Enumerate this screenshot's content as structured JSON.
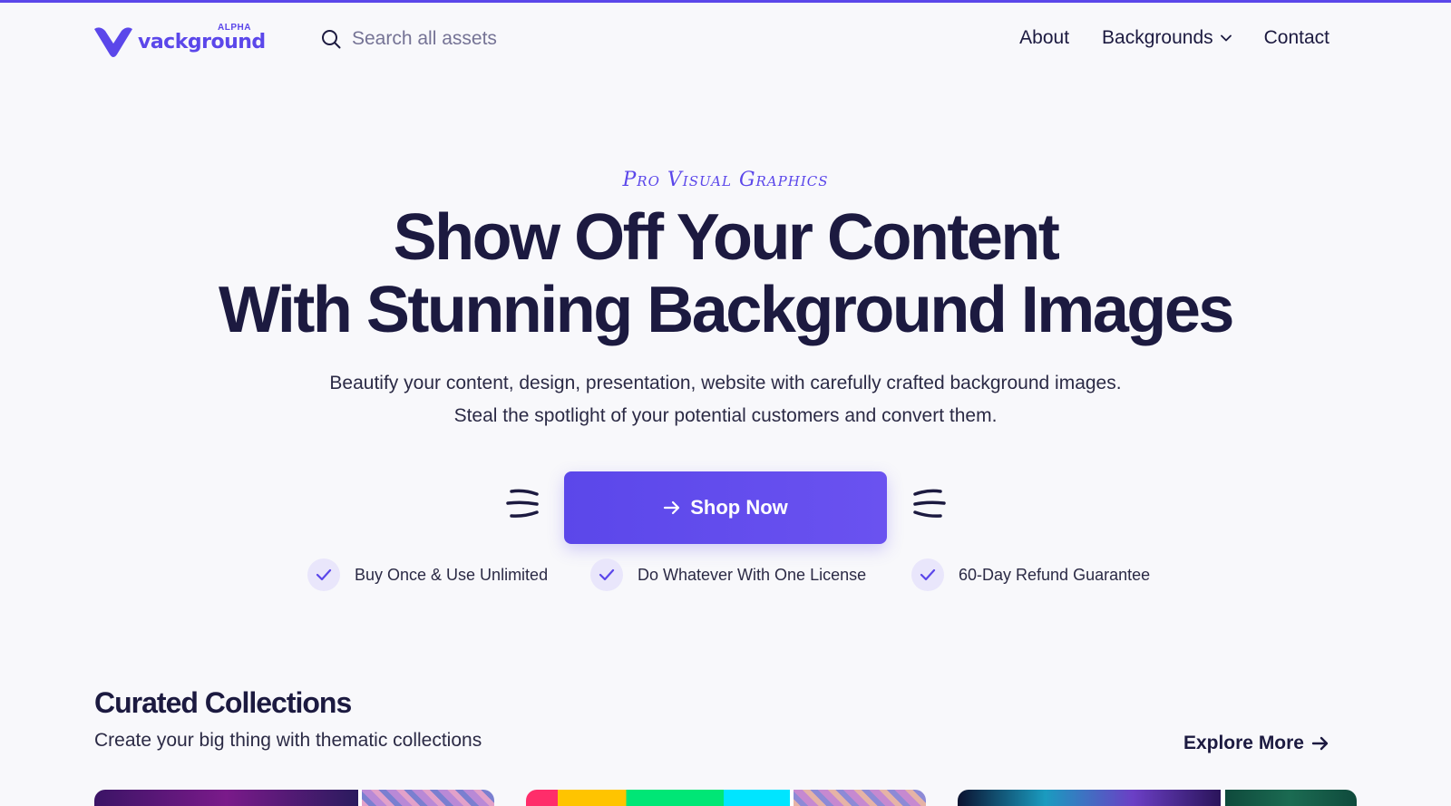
{
  "brand": {
    "name": "vackground",
    "badge": "ALPHA",
    "color": "#5b47ea"
  },
  "search": {
    "placeholder": "Search all assets",
    "icon": "search-icon"
  },
  "nav": {
    "about": "About",
    "backgrounds": "Backgrounds",
    "contact": "Contact"
  },
  "hero": {
    "eyebrow": "Pro Visual Graphics",
    "title_line1": "Show Off Your Content",
    "title_line2": "With Stunning Background Images",
    "sub_line1": "Beautify your content, design, presentation, website with carefully crafted background images.",
    "sub_line2": "Steal the spotlight of your potential customers and convert them.",
    "cta": "Shop Now"
  },
  "features": [
    {
      "label": "Buy Once & Use Unlimited"
    },
    {
      "label": "Do Whatever With One License"
    },
    {
      "label": "60-Day Refund Guarantee"
    }
  ],
  "collections": {
    "title": "Curated Collections",
    "subtitle": "Create your big thing with thematic collections",
    "explore": "Explore More"
  },
  "colors": {
    "accent": "#5b47ea",
    "text": "#1c1a40",
    "background": "#f8f8fb",
    "check_bg": "#e9e6fb"
  }
}
